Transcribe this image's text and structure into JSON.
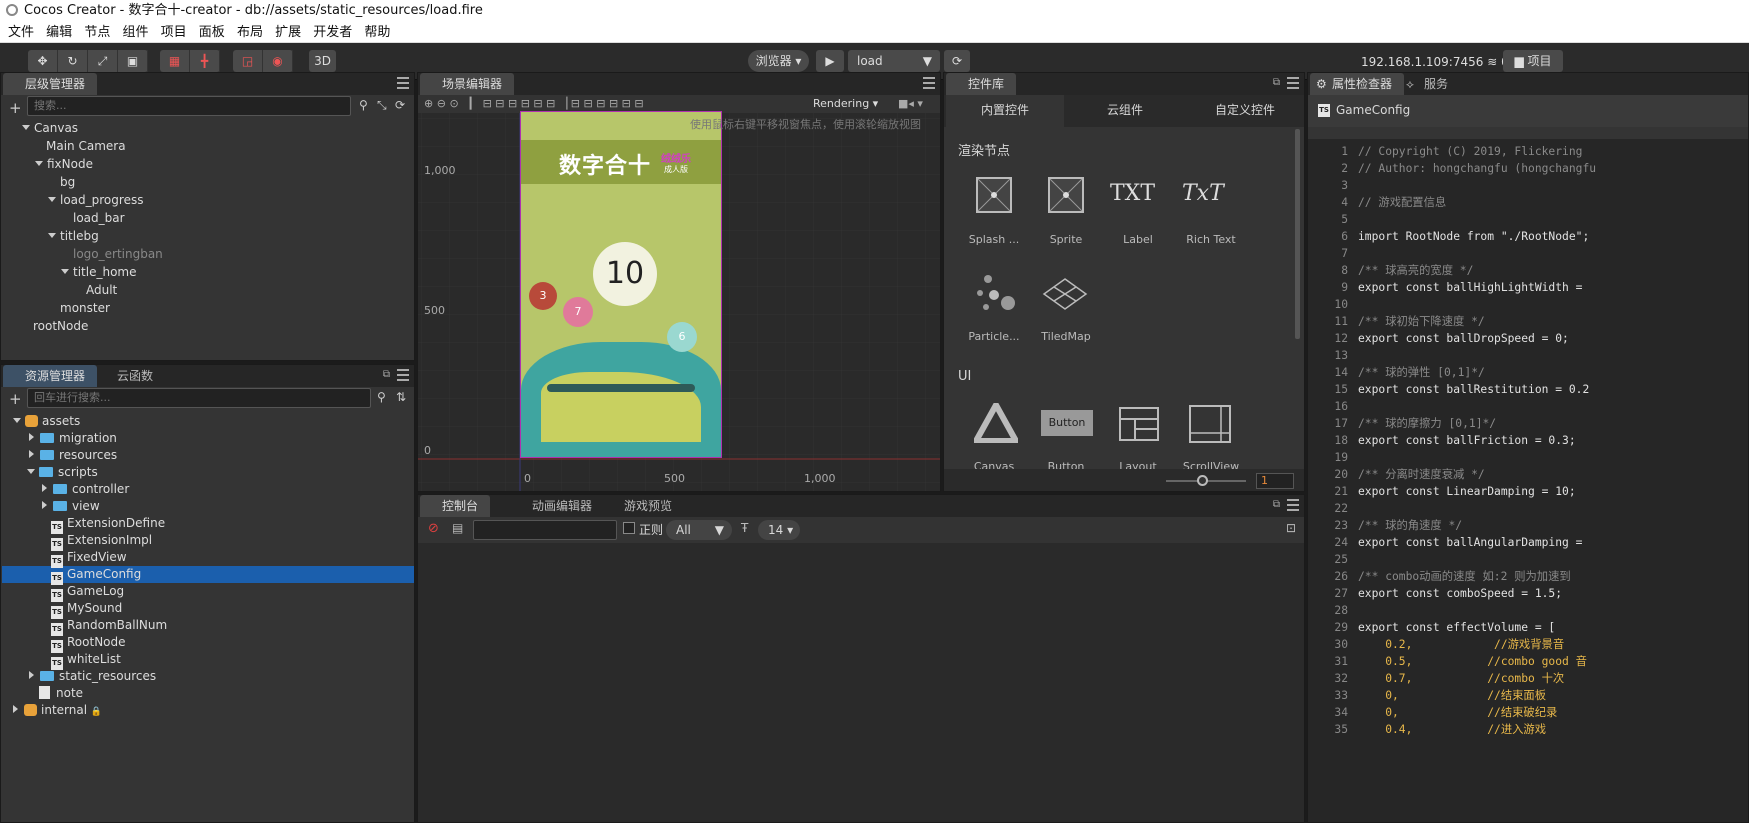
{
  "window": {
    "title": "Cocos Creator - 数字合十-creator - db://assets/static_resources/load.fire"
  },
  "menu": [
    "文件",
    "编辑",
    "节点",
    "组件",
    "项目",
    "面板",
    "布局",
    "扩展",
    "开发者",
    "帮助"
  ],
  "toolbar": {
    "mode_3d": "3D",
    "platform": "浏览器 ▾",
    "scene_select": "load",
    "ip": "192.168.1.109:7456",
    "count": "0",
    "project_btn": "项目"
  },
  "hierarchy": {
    "title": "层级管理器",
    "search_placeholder": "搜索...",
    "nodes": [
      "Canvas",
      "Main Camera",
      "fixNode",
      "bg",
      "load_progress",
      "load_bar",
      "titlebg",
      "logo_ertingban",
      "title_home",
      "Adult",
      "monster",
      "rootNode"
    ]
  },
  "assets": {
    "tab1": "资源管理器",
    "tab2": "云函数",
    "search_placeholder": "回车进行搜索...",
    "items": [
      "assets",
      "migration",
      "resources",
      "scripts",
      "controller",
      "view",
      "ExtensionDefine",
      "ExtensionImpl",
      "FixedView",
      "GameConfig",
      "GameLog",
      "MySound",
      "RandomBallNum",
      "RootNode",
      "whiteList",
      "static_resources",
      "note",
      "internal"
    ],
    "selected": "GameConfig"
  },
  "scene": {
    "title": "场景编辑器",
    "render_mode": "Rendering",
    "hint": "使用鼠标右键平移视窗焦点，使用滚轮缩放视图",
    "y_labels": [
      "1,000",
      "500",
      "0"
    ],
    "x_labels": [
      "0",
      "500",
      "1,000"
    ],
    "game_title": "数字合十",
    "game_badge1": "绒绒乐",
    "game_badge2": "成人版",
    "ball_numbers": [
      "10",
      "3",
      "7",
      "6"
    ]
  },
  "widgets": {
    "title": "控件库",
    "tabs": [
      "内置控件",
      "云组件",
      "自定义控件"
    ],
    "section1": "渲染节点",
    "section2": "UI",
    "render_items": [
      "Splash ...",
      "Sprite",
      "Label",
      "Rich Text",
      "Particle...",
      "TiledMap"
    ],
    "ui_items": [
      "Canvas",
      "Button",
      "Layout",
      "ScrollView"
    ],
    "icon_text": {
      "label": "TXT",
      "rich": "TxT",
      "button": "Button"
    },
    "zoom_value": "1"
  },
  "console": {
    "tabs": [
      "控制台",
      "动画编辑器",
      "游戏预览"
    ],
    "regex_label": "正则",
    "level": "All",
    "font_size": "14"
  },
  "inspector": {
    "tabs": [
      "属性检查器",
      "服务"
    ],
    "file": "GameConfig",
    "code": [
      {
        "n": "1",
        "t": "// Copyright (C) 2019, Flickering",
        "c": "cm"
      },
      {
        "n": "2",
        "t": "// Author: hongchangfu (hongchangfu",
        "c": "cm"
      },
      {
        "n": "3",
        "t": "",
        "c": ""
      },
      {
        "n": "4",
        "t": "// 游戏配置信息",
        "c": "cm"
      },
      {
        "n": "5",
        "t": "",
        "c": ""
      },
      {
        "n": "6",
        "t": "import RootNode from \"./RootNode\";",
        "c": "kw"
      },
      {
        "n": "7",
        "t": "",
        "c": ""
      },
      {
        "n": "8",
        "t": "/** 球高亮的宽度 */",
        "c": "cm"
      },
      {
        "n": "9",
        "t": "export const ballHighLightWidth =",
        "c": "kw"
      },
      {
        "n": "10",
        "t": "",
        "c": ""
      },
      {
        "n": "11",
        "t": "/** 球初始下降速度 */",
        "c": "cm"
      },
      {
        "n": "12",
        "t": "export const ballDropSpeed = 0;",
        "c": "kw"
      },
      {
        "n": "13",
        "t": "",
        "c": ""
      },
      {
        "n": "14",
        "t": "/** 球的弹性 [0,1]*/",
        "c": "cm"
      },
      {
        "n": "15",
        "t": "export const ballRestitution = 0.2",
        "c": "kw"
      },
      {
        "n": "16",
        "t": "",
        "c": ""
      },
      {
        "n": "17",
        "t": "/** 球的摩擦力 [0,1]*/",
        "c": "cm"
      },
      {
        "n": "18",
        "t": "export const ballFriction = 0.3;",
        "c": "kw"
      },
      {
        "n": "19",
        "t": "",
        "c": ""
      },
      {
        "n": "20",
        "t": "/** 分离时速度衰减 */",
        "c": "cm"
      },
      {
        "n": "21",
        "t": "export const LinearDamping = 10;",
        "c": "kw"
      },
      {
        "n": "22",
        "t": "",
        "c": ""
      },
      {
        "n": "23",
        "t": "/** 球的角速度 */",
        "c": "cm"
      },
      {
        "n": "24",
        "t": "export const ballAngularDamping =",
        "c": "kw"
      },
      {
        "n": "25",
        "t": "",
        "c": ""
      },
      {
        "n": "26",
        "t": "/** combo动画的速度 如:2 则为加速到",
        "c": "cm"
      },
      {
        "n": "27",
        "t": "export const comboSpeed = 1.5;",
        "c": "kw"
      },
      {
        "n": "28",
        "t": "",
        "c": ""
      },
      {
        "n": "29",
        "t": "export const effectVolume = [",
        "c": "kw"
      },
      {
        "n": "30",
        "t": "    0.2,            //游戏背景音",
        "c": "num"
      },
      {
        "n": "31",
        "t": "    0.5,           //combo good 音",
        "c": "num"
      },
      {
        "n": "32",
        "t": "    0.7,           //combo 十次",
        "c": "num"
      },
      {
        "n": "33",
        "t": "    0,             //结束面板",
        "c": "num"
      },
      {
        "n": "34",
        "t": "    0,             //结束破纪录",
        "c": "num"
      },
      {
        "n": "35",
        "t": "    0.4,           //进入游戏",
        "c": "num"
      }
    ]
  }
}
